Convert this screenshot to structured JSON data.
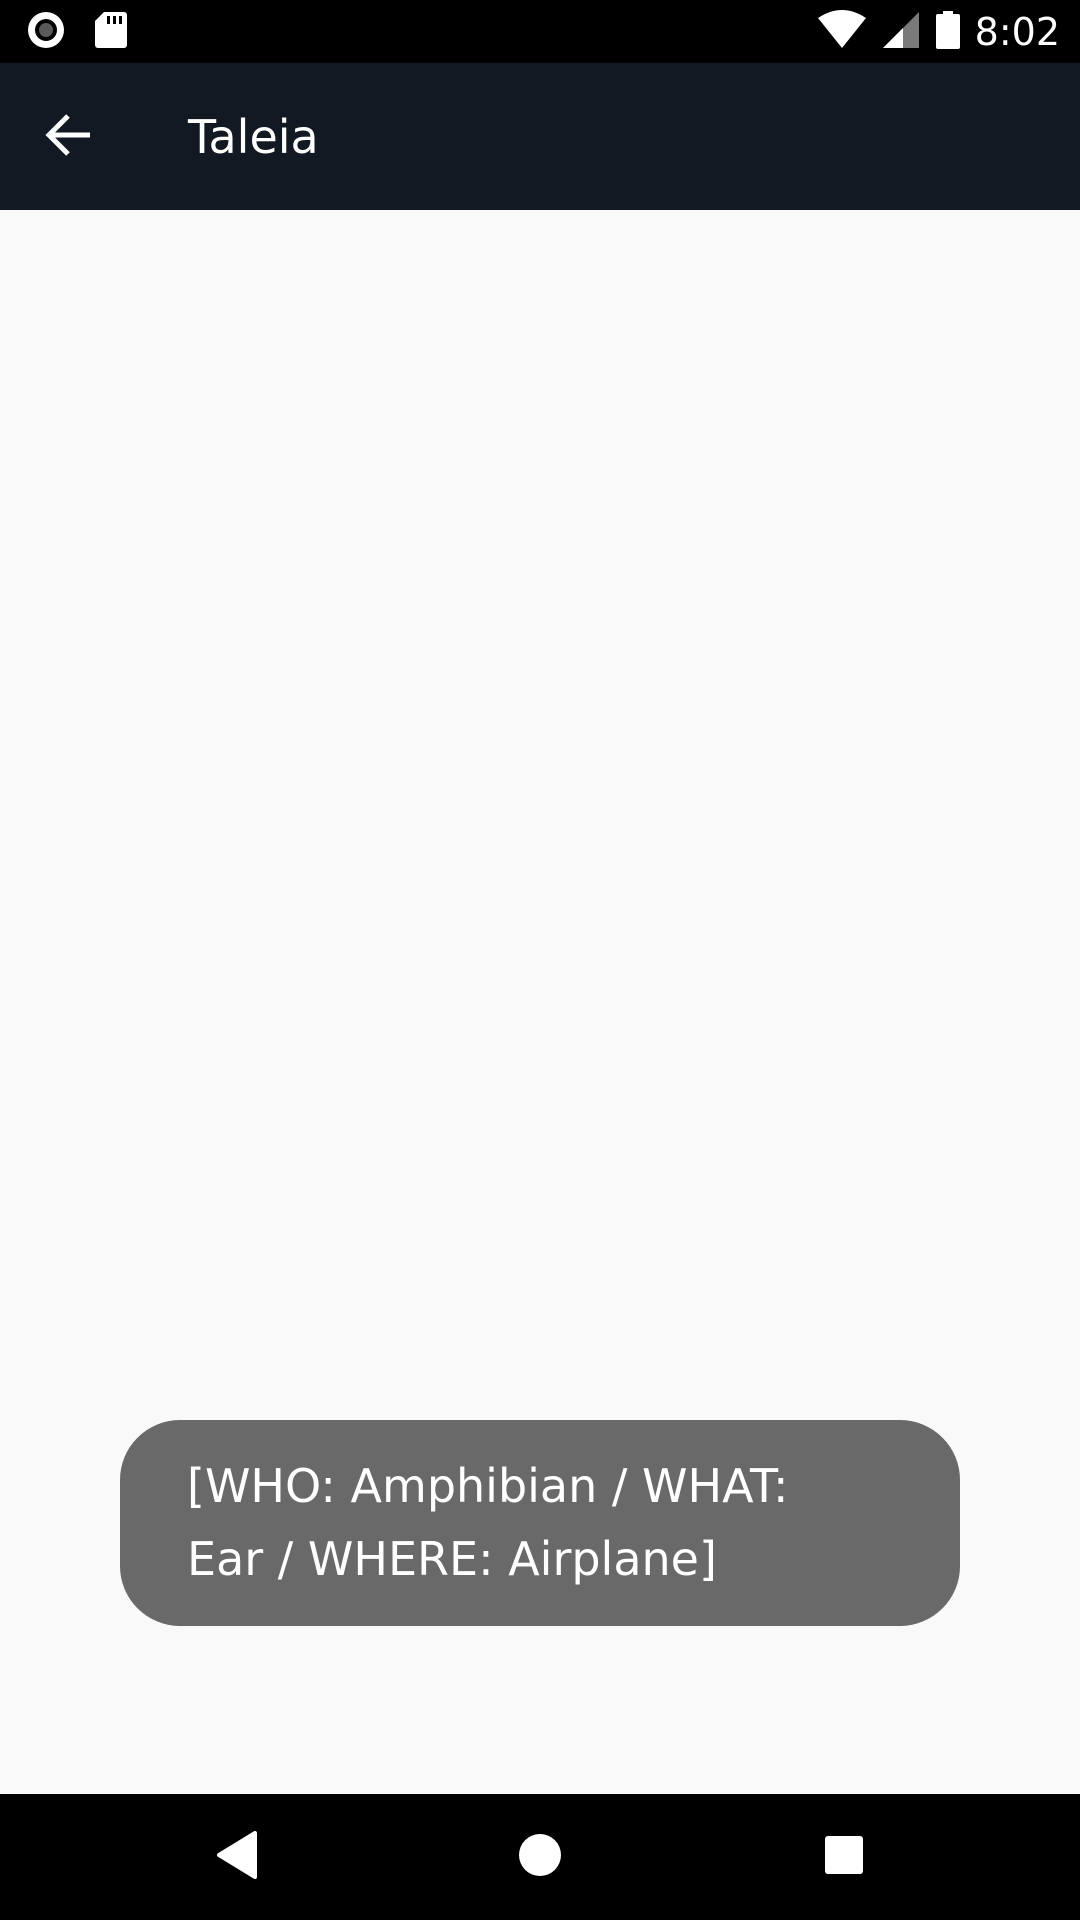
{
  "status_bar": {
    "time": "8:02",
    "left_icons": [
      "record-icon",
      "sd-card-icon"
    ],
    "right_icons": [
      "wifi-icon",
      "signal-icon",
      "battery-icon"
    ]
  },
  "app_bar": {
    "back_icon": "arrow-back-icon",
    "title": "Taleia",
    "background_color": "#121922"
  },
  "toast": {
    "line1": "[WHO: Amphibian / WHAT:",
    "line2": "Ear / WHERE: Airplane]",
    "background_color": "#696969"
  },
  "nav_bar": {
    "buttons": [
      "back-triangle-icon",
      "home-circle-icon",
      "recents-square-icon"
    ]
  }
}
